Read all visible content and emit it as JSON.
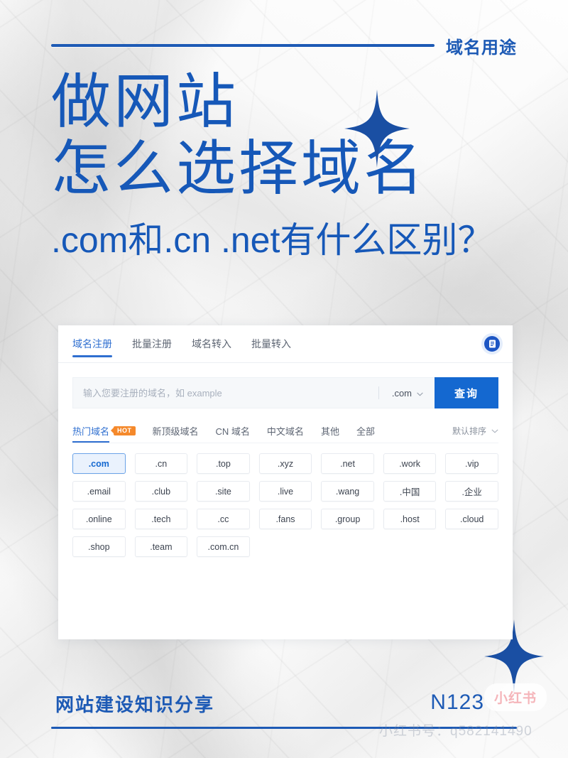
{
  "header": {
    "label": "域名用途",
    "rule_color": "#1d5ab5"
  },
  "hero": {
    "line1": "做网站",
    "line2": "怎么选择域名",
    "subtitle": ".com和.cn .net有什么区别？",
    "text_color": "#1658b8",
    "sparkle_color": "#1a4fa3"
  },
  "panel": {
    "badge_icon": "document-icon",
    "tabs": [
      {
        "label": "域名注册",
        "active": true
      },
      {
        "label": "批量注册",
        "active": false
      },
      {
        "label": "域名转入",
        "active": false
      },
      {
        "label": "批量转入",
        "active": false
      }
    ],
    "search": {
      "placeholder": "输入您要注册的域名，如 example",
      "value": "",
      "suffix": ".com",
      "suffix_icon": "chevron-down-icon",
      "button_label": "查询",
      "button_color": "#1468d0"
    },
    "filters": [
      {
        "label": "热门域名",
        "active": true,
        "badge": "HOT"
      },
      {
        "label": "新顶级域名",
        "active": false,
        "badge": ""
      },
      {
        "label": "CN 域名",
        "active": false,
        "badge": ""
      },
      {
        "label": "中文域名",
        "active": false,
        "badge": ""
      },
      {
        "label": "其他",
        "active": false,
        "badge": ""
      },
      {
        "label": "全部",
        "active": false,
        "badge": ""
      }
    ],
    "sort": {
      "label": "默认排序",
      "icon": "chevron-down-icon"
    },
    "chips": [
      {
        "label": ".com",
        "selected": true
      },
      {
        "label": ".cn",
        "selected": false
      },
      {
        "label": ".top",
        "selected": false
      },
      {
        "label": ".xyz",
        "selected": false
      },
      {
        "label": ".net",
        "selected": false
      },
      {
        "label": ".work",
        "selected": false
      },
      {
        "label": ".vip",
        "selected": false
      },
      {
        "label": ".email",
        "selected": false
      },
      {
        "label": ".club",
        "selected": false
      },
      {
        "label": ".site",
        "selected": false
      },
      {
        "label": ".live",
        "selected": false
      },
      {
        "label": ".wang",
        "selected": false
      },
      {
        "label": ".中国",
        "selected": false
      },
      {
        "label": ".企业",
        "selected": false
      },
      {
        "label": ".online",
        "selected": false
      },
      {
        "label": ".tech",
        "selected": false
      },
      {
        "label": ".cc",
        "selected": false
      },
      {
        "label": ".fans",
        "selected": false
      },
      {
        "label": ".group",
        "selected": false
      },
      {
        "label": ".host",
        "selected": false
      },
      {
        "label": ".cloud",
        "selected": false
      },
      {
        "label": ".shop",
        "selected": false
      },
      {
        "label": ".team",
        "selected": false
      },
      {
        "label": ".com.cn",
        "selected": false
      }
    ]
  },
  "footer": {
    "text": "网站建设知识分享",
    "code": "N123",
    "xhs_pill": "小红书",
    "watermark": "小红书号：q582141490"
  }
}
